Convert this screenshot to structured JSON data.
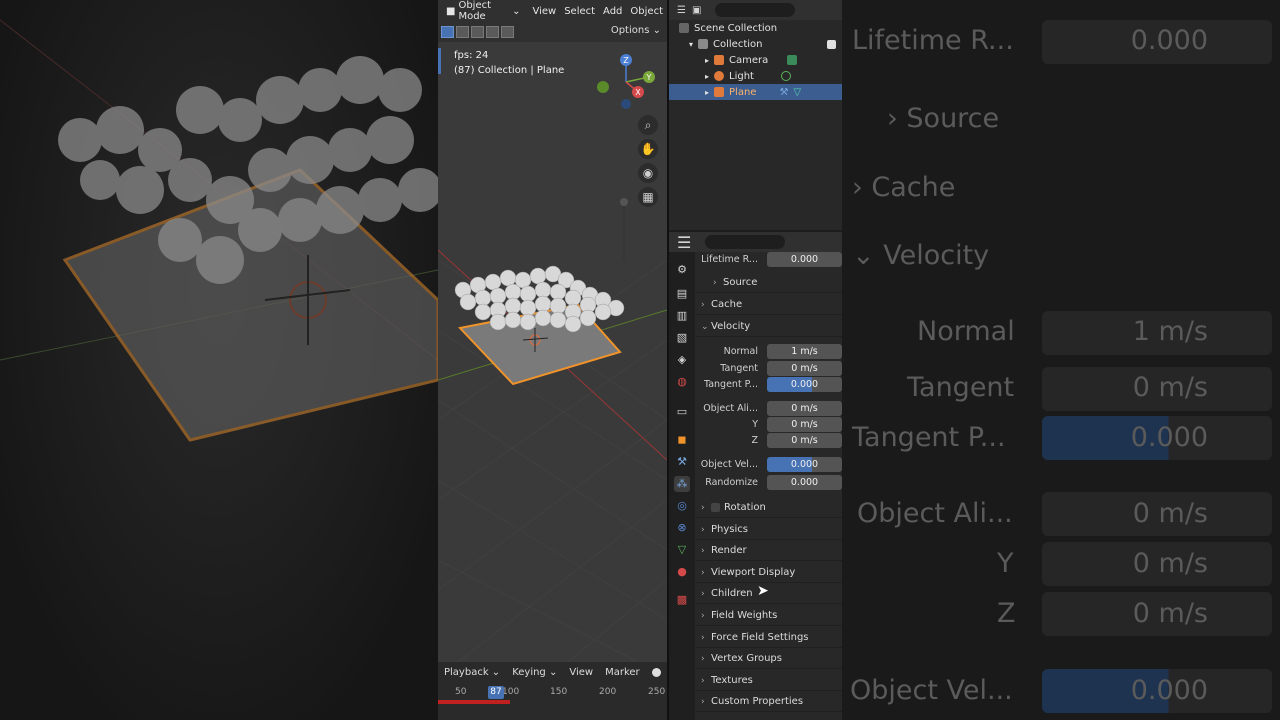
{
  "viewport": {
    "mode": "Object Mode",
    "menu": [
      "View",
      "Select",
      "Add",
      "Object"
    ],
    "options": "Options",
    "fps": "fps: 24",
    "context": "(87) Collection | Plane",
    "gizmo_axes": [
      "Z",
      "Y",
      "X"
    ],
    "nav_icons": [
      "zoom-icon",
      "hand-icon",
      "camera-icon",
      "grid-icon"
    ]
  },
  "timeline": {
    "menu": [
      "Playback",
      "Keying",
      "View",
      "Marker"
    ],
    "frames": [
      "50",
      "100",
      "150",
      "200",
      "250"
    ],
    "current_frame": "87"
  },
  "outliner": {
    "root": "Scene Collection",
    "items": [
      {
        "name": "Collection",
        "type": "collection"
      },
      {
        "name": "Camera",
        "type": "camera"
      },
      {
        "name": "Light",
        "type": "light"
      },
      {
        "name": "Plane",
        "type": "mesh",
        "selected": true
      }
    ]
  },
  "properties": {
    "lifetime_random_label": "Lifetime R...",
    "lifetime_random_value": "0.000",
    "source": "Source",
    "cache": "Cache",
    "velocity": "Velocity",
    "normal_label": "Normal",
    "normal_value": "1 m/s",
    "tangent_label": "Tangent",
    "tangent_value": "0 m/s",
    "tangent_phase_label": "Tangent P...",
    "tangent_phase_value": "0.000",
    "object_align_label": "Object Ali...",
    "object_align_x": "0 m/s",
    "y_label": "Y",
    "object_align_y": "0 m/s",
    "z_label": "Z",
    "object_align_z": "0 m/s",
    "object_vel_label": "Object Vel...",
    "object_vel_value": "0.000",
    "randomize_label": "Randomize",
    "randomize_value": "0.000",
    "sections": [
      "Rotation",
      "Physics",
      "Render",
      "Viewport Display",
      "Children",
      "Field Weights",
      "Force Field Settings",
      "Vertex Groups",
      "Textures",
      "Custom Properties"
    ]
  },
  "colors": {
    "accent": "#4772b3",
    "selection_orange": "#f0932b",
    "playhead_red": "#c02020"
  }
}
